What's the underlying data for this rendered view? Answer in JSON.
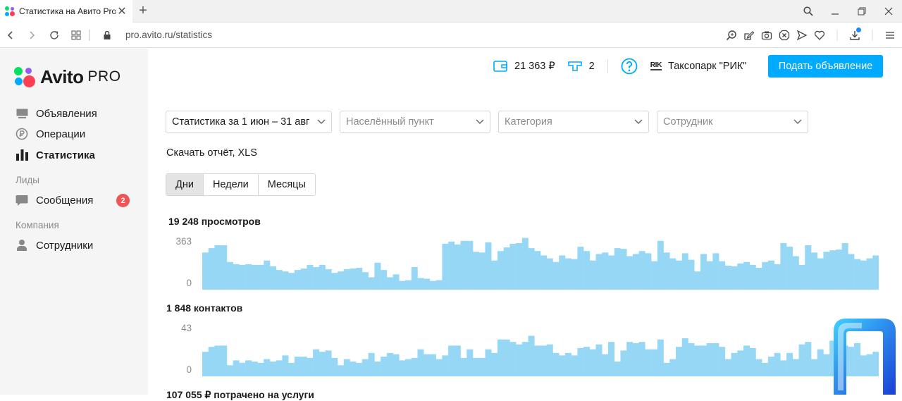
{
  "browser": {
    "tab_title": "Статистика на Авито Pro",
    "url_host": "pro.avito.ru",
    "url_path": "/statistics"
  },
  "sidebar": {
    "logo_text": "Avito",
    "logo_pro": "PRO",
    "items": [
      {
        "label": "Объявления",
        "icon": "listings-icon"
      },
      {
        "label": "Операции",
        "icon": "ruble-icon"
      },
      {
        "label": "Статистика",
        "icon": "bar-chart-icon",
        "active": true
      }
    ],
    "section_leads": "Лиды",
    "messages": {
      "label": "Сообщения",
      "badge": "2"
    },
    "section_company": "Компания",
    "employees": {
      "label": "Сотрудники"
    }
  },
  "header": {
    "wallet": "21 363 ₽",
    "promo_count": "2",
    "company_logo": "RIK",
    "company_name": "Таксопарк \"РИК\"",
    "post_button": "Подать объявление"
  },
  "filters": {
    "period": "Статистика за 1 июн – 31 авг",
    "city_placeholder": "Населённый пункт",
    "category_placeholder": "Категория",
    "employee_placeholder": "Сотрудник"
  },
  "download_link": "Скачать отчёт, XLS",
  "period_tabs": [
    {
      "label": "Дни",
      "selected": true
    },
    {
      "label": "Недели",
      "selected": false
    },
    {
      "label": "Месяцы",
      "selected": false
    }
  ],
  "colors": {
    "accent": "#00aaff",
    "bar": "#97d7f6",
    "badge": "#f05454"
  },
  "chart_data": [
    {
      "type": "bar",
      "title": "19 248 просмотров",
      "ylim": [
        0,
        363
      ],
      "ytick_labels": [
        "363",
        "0"
      ],
      "values": [
        255,
        285,
        305,
        305,
        190,
        175,
        170,
        175,
        170,
        170,
        200,
        160,
        135,
        125,
        115,
        135,
        145,
        170,
        155,
        170,
        140,
        115,
        125,
        140,
        145,
        150,
        120,
        85,
        185,
        135,
        85,
        105,
        60,
        65,
        155,
        80,
        75,
        60,
        65,
        315,
        330,
        310,
        335,
        335,
        260,
        255,
        325,
        200,
        265,
        290,
        315,
        320,
        355,
        285,
        265,
        235,
        215,
        190,
        235,
        215,
        210,
        295,
        265,
        200,
        245,
        255,
        235,
        285,
        280,
        230,
        245,
        265,
        250,
        195,
        335,
        255,
        215,
        200,
        250,
        205,
        125,
        245,
        195,
        250,
        195,
        165,
        160,
        180,
        190,
        170,
        150,
        190,
        200,
        175,
        320,
        295,
        230,
        170,
        305,
        255,
        215,
        260,
        270,
        275,
        320,
        245,
        210,
        200,
        215,
        235
      ]
    },
    {
      "type": "bar",
      "title": "1 848 контактов",
      "ylim": [
        0,
        43
      ],
      "ytick_labels": [
        "43",
        "0"
      ],
      "values": [
        20,
        24,
        25,
        25,
        9,
        13,
        11,
        13,
        12,
        11,
        14,
        12,
        13,
        17,
        11,
        16,
        16,
        15,
        22,
        20,
        21,
        15,
        9,
        14,
        12,
        11,
        14,
        19,
        12,
        16,
        19,
        18,
        13,
        14,
        15,
        22,
        18,
        18,
        14,
        17,
        25,
        25,
        15,
        22,
        15,
        15,
        22,
        19,
        30,
        30,
        28,
        26,
        28,
        33,
        25,
        25,
        26,
        19,
        17,
        19,
        17,
        23,
        24,
        22,
        26,
        18,
        28,
        12,
        21,
        28,
        27,
        28,
        22,
        22,
        30,
        11,
        14,
        24,
        31,
        27,
        25,
        25,
        27,
        27,
        24,
        14,
        19,
        21,
        25,
        23,
        14,
        11,
        16,
        19,
        13,
        19,
        14,
        26,
        28,
        14,
        22,
        18,
        29,
        25,
        25,
        24,
        27,
        17,
        18,
        20
      ]
    }
  ],
  "partial_metric": "107 055 ₽ потрачено на услуги"
}
